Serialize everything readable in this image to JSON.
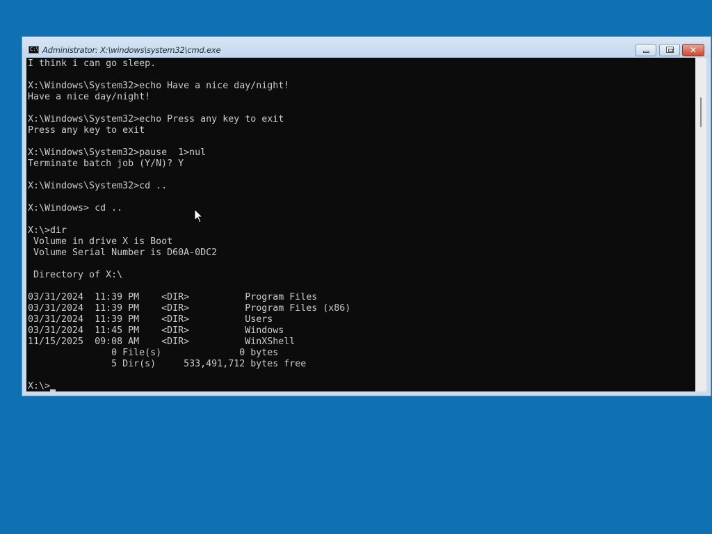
{
  "window": {
    "title": "Administrator: X:\\windows\\system32\\cmd.exe",
    "icon": "cmd-icon",
    "icon_text": "C:\\",
    "close_glyph": "✕"
  },
  "console": {
    "lines": [
      "I think i can go sleep.",
      "",
      "X:\\Windows\\System32>echo Have a nice day/night!",
      "Have a nice day/night!",
      "",
      "X:\\Windows\\System32>echo Press any key to exit",
      "Press any key to exit",
      "",
      "X:\\Windows\\System32>pause  1>nul",
      "Terminate batch job (Y/N)? Y",
      "",
      "X:\\Windows\\System32>cd ..",
      "",
      "X:\\Windows> cd ..",
      "",
      "X:\\>dir",
      " Volume in drive X is Boot",
      " Volume Serial Number is D60A-0DC2",
      "",
      " Directory of X:\\",
      "",
      "03/31/2024  11:39 PM    <DIR>          Program Files",
      "03/31/2024  11:39 PM    <DIR>          Program Files (x86)",
      "03/31/2024  11:39 PM    <DIR>          Users",
      "03/31/2024  11:45 PM    <DIR>          Windows",
      "11/15/2025  09:08 AM    <DIR>          WinXShell",
      "               0 File(s)              0 bytes",
      "               5 Dir(s)     533,491,712 bytes free",
      "",
      "X:\\>"
    ]
  },
  "colors": {
    "desktop": "#0f71b1",
    "console_bg": "#0c0c0c",
    "console_fg": "#cccccc",
    "close_button": "#c94a36"
  }
}
